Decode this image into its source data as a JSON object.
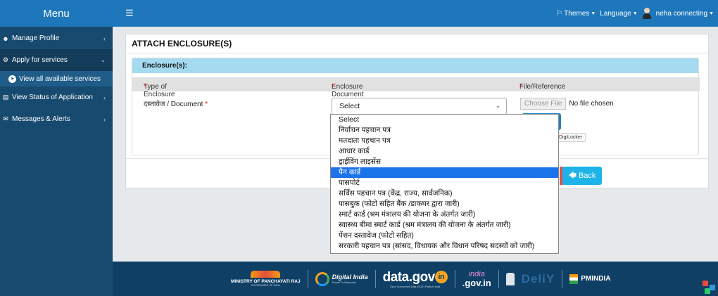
{
  "sidebar": {
    "title": "Menu",
    "items": [
      {
        "icon": "users-icon",
        "label": "Manage Profile"
      },
      {
        "icon": "gears-icon",
        "label": "Apply for services"
      },
      {
        "icon": "list-icon",
        "label": "View Status of Application"
      },
      {
        "icon": "envelope-icon",
        "label": "Messages & Alerts"
      }
    ],
    "subitem": {
      "icon": "arrow-circle-icon",
      "label": "View all available services"
    }
  },
  "topbar": {
    "themes": "Themes",
    "language": "Language",
    "user": "neha connecting"
  },
  "panel": {
    "title": "ATTACH ENCLOSURE(S)",
    "section_title": "Enclosure(s):",
    "col_type": "Type of Enclosure",
    "col_document": "Enclosure Document",
    "col_file": "File/Reference",
    "required_mark": "*",
    "doc_label": "दस्तावेज / Document",
    "select_value": "Select",
    "file_button": "Choose File",
    "file_status": "No file chosen",
    "digilocker": "DigiLocker",
    "back_label": "Back"
  },
  "dropdown": {
    "selected_index": 5,
    "options": [
      "Select",
      "निर्वाचन पहचान पत्र",
      "मतदाता पहचान पत्र",
      "आधार कार्ड",
      "ड्राईविंग लाइसेंस",
      "पैन कार्ड",
      "पासपोर्ट",
      "सर्विस पहचान पत्र (केंद्र, राज्य, सार्वजनिक)",
      "पासबुक (फोटो सहित बैंक /डाकघर द्वारा जारी)",
      "स्मार्ट कार्ड (श्रम मंत्रालय की योजना के अंतर्गत जारी)",
      "स्वास्थ्य बीमा स्मार्ट कार्ड (श्रम मंत्रालय की योजना के अंतर्गत जारी)",
      "पेंशन दस्तावेज (फोटो सहित)",
      "सरकारी पहचान पत्र (सांसद, विधायक और विधान परिषद सदस्यों को जारी)"
    ]
  },
  "footer": {
    "mopr": "MINISTRY OF PANCHAYATI RAJ",
    "mopr_sub": "GOVERNMENT OF INDIA",
    "digital_india": "Digital India",
    "digital_india_sub": "Power To Empower",
    "datagov": "data.gov",
    "datagov_badge": "in",
    "datagov_sub": "Open Government Data (OGD) Platform India",
    "india_gov_1": "india",
    "india_gov_2": ".gov.in",
    "dely": "DeliY",
    "pmindia": "PMINDIA"
  },
  "colors": {
    "sidebar": "#174a6f",
    "topbar": "#1e77bb",
    "section_head": "#a4dbf1",
    "dropdown_selected": "#1a73e8",
    "back_button": "#1eb3e8",
    "footer": "#0f3f64"
  }
}
